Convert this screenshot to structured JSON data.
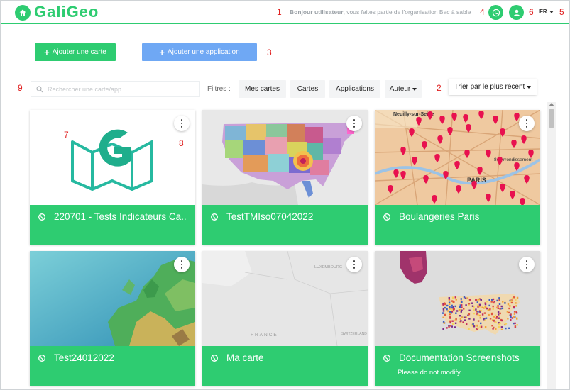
{
  "header": {
    "logo_text": "GaliGeo",
    "greeting_user": "Bonjour utilisateur",
    "greeting_rest": ", vous faites partie de l'organisation Bac à sable",
    "language": "FR"
  },
  "annotations": [
    "1",
    "2",
    "3",
    "4",
    "5",
    "6",
    "7",
    "8",
    "9"
  ],
  "actions": {
    "add_map": "Ajouter une carte",
    "add_app": "Ajouter une application"
  },
  "search": {
    "placeholder": "Rechercher une carte/app"
  },
  "filters": {
    "label": "Filtres :",
    "my_maps": "Mes cartes",
    "maps": "Cartes",
    "applications": "Applications",
    "author": "Auteur"
  },
  "sort": {
    "label": "Trier par le plus récent"
  },
  "cards": [
    {
      "title": "220701 - Tests Indicateurs Ca...",
      "subtitle": ""
    },
    {
      "title": "TestTMIso07042022",
      "subtitle": ""
    },
    {
      "title": "Boulangeries Paris",
      "subtitle": ""
    },
    {
      "title": "Test24012022",
      "subtitle": ""
    },
    {
      "title": "Ma carte",
      "subtitle": ""
    },
    {
      "title": "Documentation Screenshots",
      "subtitle": "Please do not modify"
    }
  ],
  "map_labels": {
    "paris_top": "Neuilly-sur-Seine",
    "paris_center": "PARIS",
    "paris_arr": "8e Arrondissement",
    "europe_country": "FRANCE",
    "europe_lux": "LUXEMBOURG",
    "europe_swiss": "SWITZERLAND"
  },
  "colors": {
    "brand_green": "#2ecc71",
    "button_blue": "#6fa8f4",
    "annotation_red": "#e02020"
  }
}
